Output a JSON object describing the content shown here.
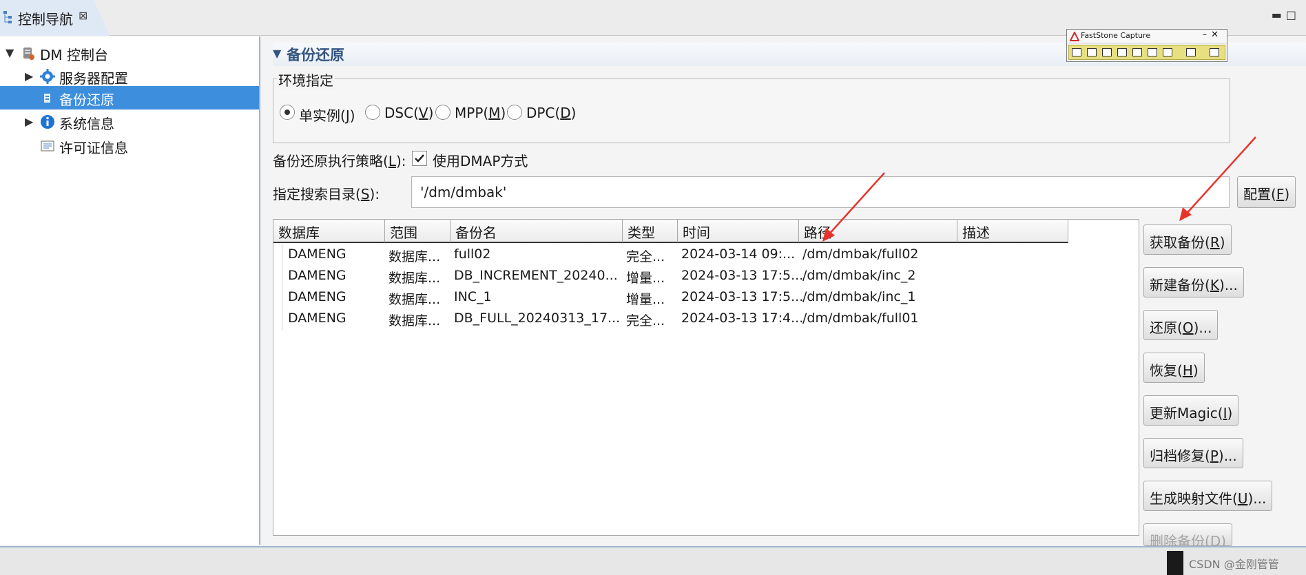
{
  "nav_view": {
    "tab_title": "控制导航",
    "close_glyph": "⊠",
    "tree": [
      {
        "label": "DM 控制台",
        "expanded": true,
        "icon": "database-icon"
      },
      {
        "label": "服务器配置",
        "icon": "gear-icon"
      },
      {
        "label": "备份还原",
        "selected": true,
        "icon": "backup-icon"
      },
      {
        "label": "系统信息",
        "icon": "info-icon"
      },
      {
        "label": "许可证信息",
        "icon": "license-icon"
      }
    ]
  },
  "section": {
    "title": "备份还原",
    "env_group_title": "环境指定",
    "env_options": [
      {
        "label": "单实例",
        "key": "J",
        "selected": true
      },
      {
        "label": "DSC",
        "key": "V",
        "selected": false
      },
      {
        "label": "MPP",
        "key": "M",
        "selected": false
      },
      {
        "label": "DPC",
        "key": "D",
        "selected": false
      }
    ],
    "strategy_label": "备份还原执行策略",
    "strategy_key": "L",
    "dmap_label": "使用DMAP方式",
    "dmap_checked": true,
    "search_dir_label": "指定搜索目录",
    "search_dir_key": "S",
    "search_dir_value": "'/dm/dmbak'",
    "config_button": {
      "label": "配置",
      "key": "F"
    }
  },
  "table": {
    "columns": [
      "数据库",
      "范围",
      "备份名",
      "类型",
      "时间",
      "路径",
      "描述"
    ],
    "rows": [
      [
        "DAMENG",
        "数据库...",
        "full02",
        "完全...",
        "2024-03-14  09:...",
        "/dm/dmbak/full02",
        ""
      ],
      [
        "DAMENG",
        "数据库...",
        "DB_INCREMENT_20240...",
        "增量...",
        "2024-03-13  17:5...",
        "/dm/dmbak/inc_2",
        ""
      ],
      [
        "DAMENG",
        "数据库...",
        "INC_1",
        "增量...",
        "2024-03-13  17:5...",
        "/dm/dmbak/inc_1",
        ""
      ],
      [
        "DAMENG",
        "数据库...",
        "DB_FULL_20240313_17...",
        "完全...",
        "2024-03-13  17:4...",
        "/dm/dmbak/full01",
        ""
      ]
    ]
  },
  "actions": [
    {
      "label": "获取备份",
      "key": "R",
      "suffix": "",
      "enabled": true
    },
    {
      "label": "新建备份",
      "key": "K",
      "suffix": "...",
      "enabled": true
    },
    {
      "label": "还原",
      "key": "O",
      "suffix": "...",
      "enabled": true
    },
    {
      "label": "恢复",
      "key": "H",
      "suffix": "",
      "enabled": true
    },
    {
      "label": "更新Magic",
      "key": "I",
      "suffix": "",
      "enabled": true
    },
    {
      "label": "归档修复",
      "key": "P",
      "suffix": "...",
      "enabled": true
    },
    {
      "label": "生成映射文件",
      "key": "U",
      "suffix": "...",
      "enabled": true
    },
    {
      "label": "删除备份",
      "key": "D",
      "suffix": "",
      "enabled": false
    }
  ],
  "overlay": {
    "title": "FastStone Capture"
  },
  "watermark": "CSDN @金刚管管",
  "colors": {
    "selection": "#3e8ede",
    "section_title": "#33557f",
    "annotation_arrow": "#e8322d"
  }
}
